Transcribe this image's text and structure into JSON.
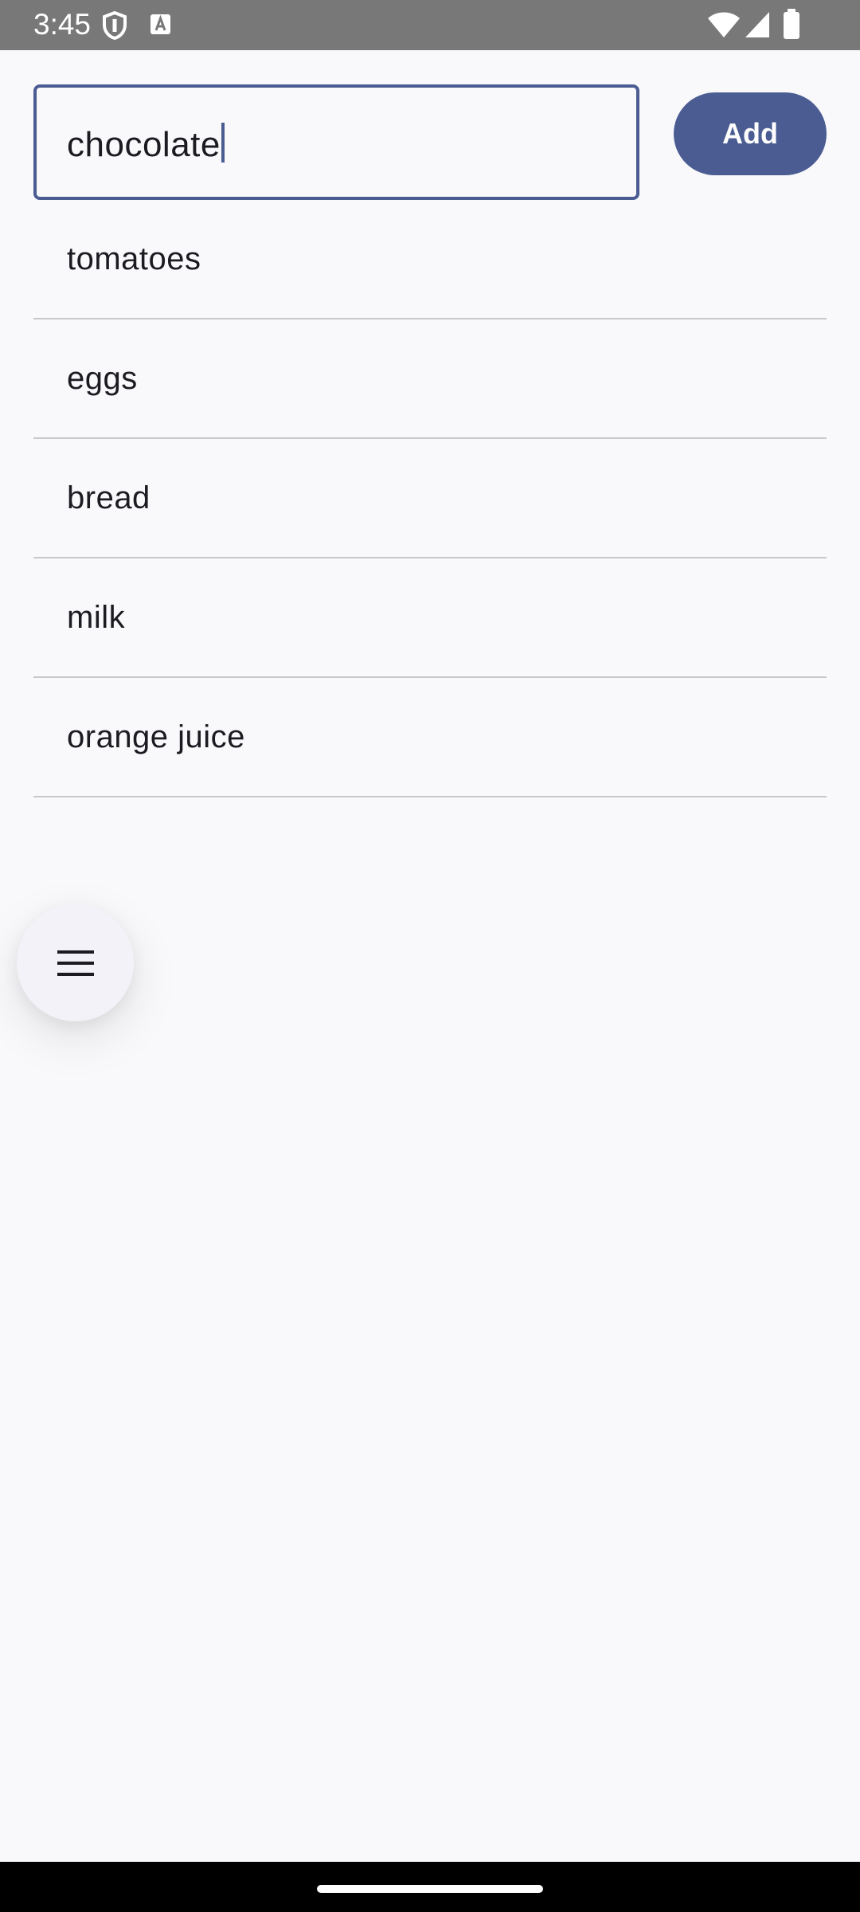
{
  "status_bar": {
    "time": "3:45",
    "icons": [
      "shield-icon",
      "font-a-icon",
      "wifi-icon",
      "cell-signal-icon",
      "battery-icon"
    ]
  },
  "input": {
    "value": "chocolate"
  },
  "add_button": {
    "label": "Add"
  },
  "list": {
    "items": [
      {
        "label": "tomatoes"
      },
      {
        "label": "eggs"
      },
      {
        "label": "bread"
      },
      {
        "label": "milk"
      },
      {
        "label": "orange juice"
      }
    ]
  },
  "fab": {
    "icon": "hamburger-menu-icon"
  },
  "colors": {
    "accent": "#4a5c92",
    "background": "#f9f9fb",
    "status_bar": "#787878",
    "divider": "#c7c7cc"
  }
}
